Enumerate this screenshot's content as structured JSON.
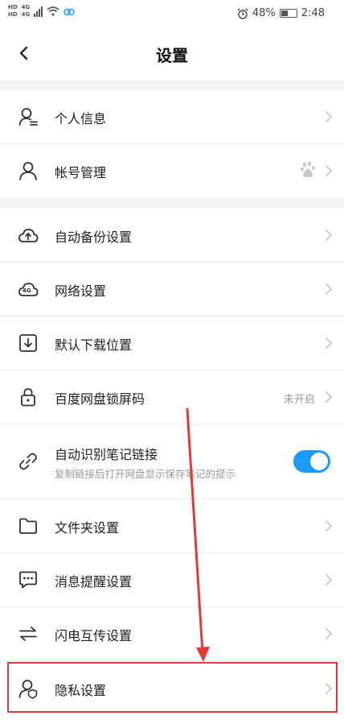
{
  "status_bar": {
    "net_top": "HD",
    "net_bottom": "HD",
    "signal_1": "4G",
    "signal_2": "4G",
    "battery": "48%",
    "time": "2:48",
    "icons": [
      "hd-icon",
      "signal-icon",
      "wifi-icon",
      "vpn-icon",
      "alarm-icon",
      "battery-icon"
    ]
  },
  "header": {
    "title": "设置",
    "back_icon": "chevron-left-icon"
  },
  "settings": {
    "account": [
      {
        "label": "个人信息",
        "icon": "profile-icon"
      },
      {
        "label": "帐号管理",
        "icon": "user-icon",
        "badge_icon": "baidu-paw-icon"
      }
    ],
    "general": [
      {
        "label": "自动备份设置",
        "icon": "cloud-upload-icon"
      },
      {
        "label": "网络设置",
        "icon": "cloud-4g-icon",
        "icon_text": "4G"
      },
      {
        "label": "默认下载位置",
        "icon": "download-box-icon"
      },
      {
        "label": "百度网盘锁屏码",
        "icon": "lock-icon",
        "value": "未开启"
      },
      {
        "label": "自动识别笔记链接",
        "sublabel": "复制链接后打开网盘显示保存笔记的提示",
        "icon": "link-icon",
        "toggle": true
      },
      {
        "label": "文件夹设置",
        "icon": "folder-icon"
      },
      {
        "label": "消息提醒设置",
        "icon": "message-icon"
      },
      {
        "label": "闪电互传设置",
        "icon": "transfer-icon"
      },
      {
        "label": "隐私设置",
        "icon": "privacy-icon"
      }
    ]
  },
  "colors": {
    "accent": "#1a9bf5",
    "annotation": "#e53935",
    "background": "#f5f5f7"
  }
}
